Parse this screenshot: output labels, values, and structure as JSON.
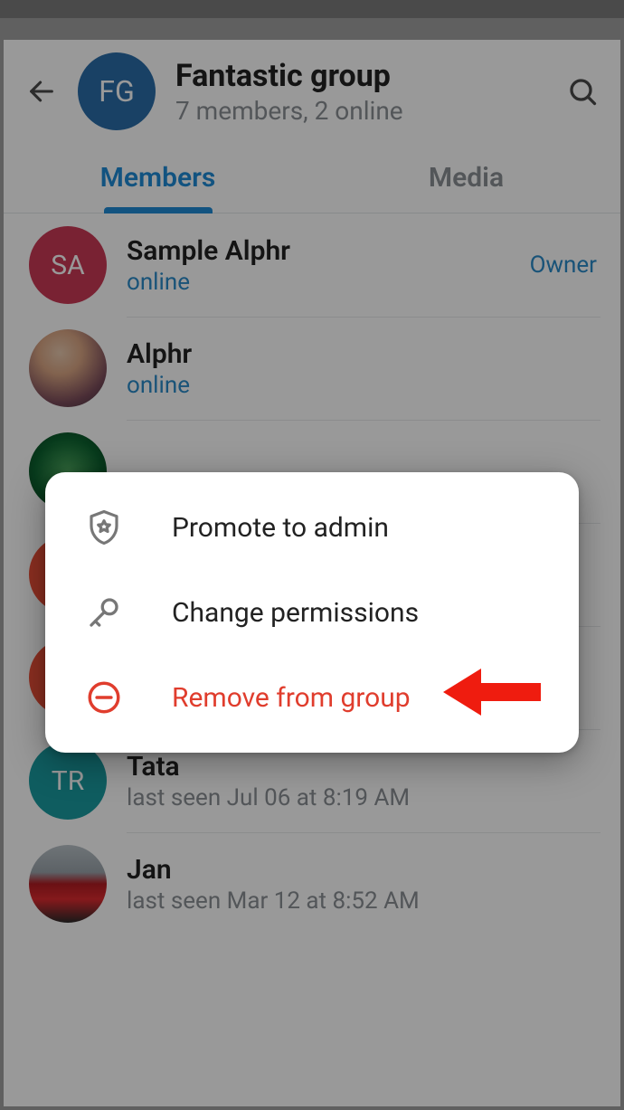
{
  "header": {
    "avatar_initials": "FG",
    "title": "Fantastic group",
    "subtitle": "7 members, 2 online"
  },
  "tabs": {
    "members": "Members",
    "media": "Media"
  },
  "members": [
    {
      "initials": "SA",
      "name": "Sample Alphr",
      "status": "online",
      "online": true,
      "role": "Owner"
    },
    {
      "initials": "",
      "name": "Alphr",
      "status": "online",
      "online": true,
      "role": ""
    },
    {
      "initials": "",
      "name": "",
      "status": "",
      "online": false,
      "role": ""
    },
    {
      "initials": "",
      "name": "",
      "status": "",
      "online": false,
      "role": ""
    },
    {
      "initials": "",
      "name": "",
      "status": "",
      "online": false,
      "role": ""
    },
    {
      "initials": "TR",
      "name": "Tata",
      "status": "last seen Jul 06 at 8:19 AM",
      "online": false,
      "role": ""
    },
    {
      "initials": "",
      "name": "Jan",
      "status": "last seen Mar 12 at 8:52 AM",
      "online": false,
      "role": ""
    }
  ],
  "popup": {
    "promote": "Promote to admin",
    "permissions": "Change permissions",
    "remove": "Remove from group"
  }
}
